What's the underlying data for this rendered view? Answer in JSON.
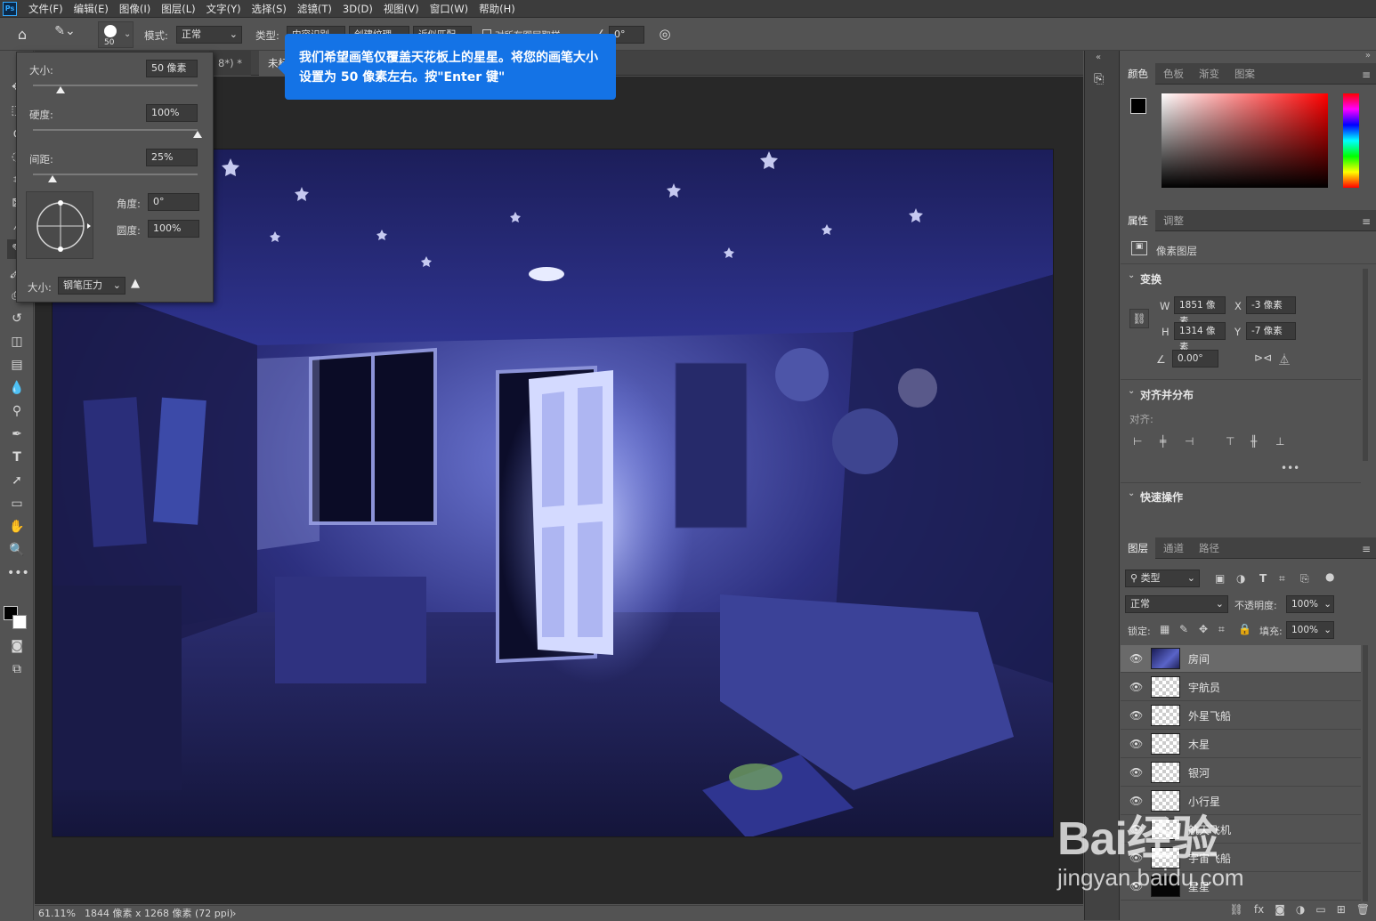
{
  "app": {
    "logo": "Ps"
  },
  "menu": [
    "文件(F)",
    "编辑(E)",
    "图像(I)",
    "图层(L)",
    "文字(Y)",
    "选择(S)",
    "滤镜(T)",
    "3D(D)",
    "视图(V)",
    "窗口(W)",
    "帮助(H)"
  ],
  "options": {
    "brush_size": "50",
    "mode_label": "模式:",
    "mode_value": "正常",
    "type_label": "类型:",
    "type_options": [
      "内容识别",
      "创建纹理",
      "近似匹配"
    ],
    "sample_all_label": "对所有图层取样",
    "angle_value": "0°"
  },
  "tabs": [
    "8*) *",
    "未标"
  ],
  "tooltip": {
    "text": "我们希望画笔仅覆盖天花板上的星星。将您的画笔大小设置为 50 像素左右。按\"Enter 键\""
  },
  "brush_panel": {
    "size_label": "大小:",
    "size_value": "50 像素",
    "size_fraction": 0.17,
    "hardness_label": "硬度:",
    "hardness_value": "100%",
    "hardness_fraction": 1.0,
    "spacing_label": "间距:",
    "spacing_value": "25%",
    "spacing_fraction": 0.12,
    "angle_label": "角度:",
    "angle_value": "0°",
    "roundness_label": "圆度:",
    "roundness_value": "100%",
    "pen_size_label": "大小:",
    "pen_size_value": "钢笔压力"
  },
  "status": {
    "zoom": "61.11%",
    "doc_info": "1844 像素 x 1268 像素 (72 ppi)"
  },
  "color_panel": {
    "tabs": [
      "颜色",
      "色板",
      "渐变",
      "图案"
    ],
    "fg": "#000000",
    "bg": "#ffffff"
  },
  "properties_panel": {
    "tabs": [
      "属性",
      "调整"
    ],
    "type_label": "像素图层",
    "transform_title": "变换",
    "w_label": "W",
    "w_value": "1851 像素",
    "h_label": "H",
    "h_value": "1314 像素",
    "x_label": "X",
    "x_value": "-3 像素",
    "y_label": "Y",
    "y_value": "-7 像素",
    "angle_value": "0.00°",
    "align_title": "对齐并分布",
    "align_label": "对齐:",
    "more": "•••",
    "quick_title": "快速操作"
  },
  "layers_panel": {
    "tabs": [
      "图层",
      "通道",
      "路径"
    ],
    "filter_value": "类型",
    "blend_value": "正常",
    "opacity_label": "不透明度:",
    "opacity_value": "100%",
    "lock_label": "锁定:",
    "fill_label": "填充:",
    "fill_value": "100%",
    "layers": [
      {
        "name": "房间",
        "selected": true,
        "thumb": "room"
      },
      {
        "name": "宇航员",
        "selected": false,
        "thumb": "transparent"
      },
      {
        "name": "外星飞船",
        "selected": false,
        "thumb": "transparent"
      },
      {
        "name": "木星",
        "selected": false,
        "thumb": "planet"
      },
      {
        "name": "银河",
        "selected": false,
        "thumb": "transparent"
      },
      {
        "name": "小行星",
        "selected": false,
        "thumb": "transparent"
      },
      {
        "name": "航天飞机",
        "selected": false,
        "thumb": "transparent"
      },
      {
        "name": "宇宙飞船",
        "selected": false,
        "thumb": "transparent"
      },
      {
        "name": "星星",
        "selected": false,
        "thumb": "black"
      }
    ]
  },
  "watermark": {
    "text": "Bai经验",
    "url": "jingyan.baidu.com"
  }
}
